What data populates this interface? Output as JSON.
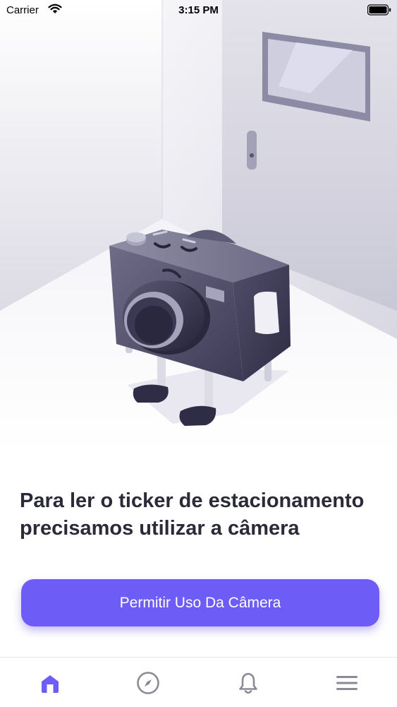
{
  "status_bar": {
    "carrier": "Carrier",
    "time": "3:15 PM"
  },
  "headline": "Para ler o ticker de estacionamento precisamos utilizar a câmera",
  "cta": {
    "label": "Permitir Uso Da Câmera"
  },
  "colors": {
    "accent": "#6d5cf6",
    "text": "#2a2a38",
    "icon_inactive": "#8a8a96"
  },
  "tabbar": {
    "items": [
      {
        "icon": "home-icon",
        "active": true
      },
      {
        "icon": "compass-icon",
        "active": false
      },
      {
        "icon": "bell-icon",
        "active": false
      },
      {
        "icon": "menu-icon",
        "active": false
      }
    ]
  }
}
